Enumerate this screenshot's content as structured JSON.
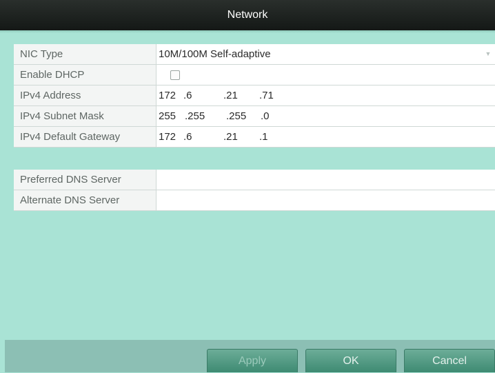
{
  "window": {
    "title": "Network"
  },
  "form": {
    "nic_type": {
      "label": "NIC Type",
      "value": "10M/100M Self-adaptive"
    },
    "enable_dhcp": {
      "label": "Enable DHCP",
      "checked": false
    },
    "ipv4_address": {
      "label": "IPv4 Address",
      "segments": [
        "172",
        ".6",
        ".21",
        ".71"
      ]
    },
    "subnet_mask": {
      "label": "IPv4 Subnet Mask",
      "segments": [
        "255",
        ".255",
        ".255",
        ".0"
      ]
    },
    "default_gateway": {
      "label": "IPv4 Default Gateway",
      "segments": [
        "172",
        ".6",
        ".21",
        ".1"
      ]
    },
    "preferred_dns": {
      "label": "Preferred DNS Server",
      "value": ""
    },
    "alternate_dns": {
      "label": "Alternate DNS Server",
      "value": ""
    }
  },
  "buttons": {
    "apply": "Apply",
    "ok": "OK",
    "cancel": "Cancel"
  },
  "icons": {
    "dropdown": "chevron-down-icon"
  },
  "colors": {
    "background": "#a9e3d5",
    "title_bar": "#1e2320",
    "button": "#4f9a82"
  }
}
